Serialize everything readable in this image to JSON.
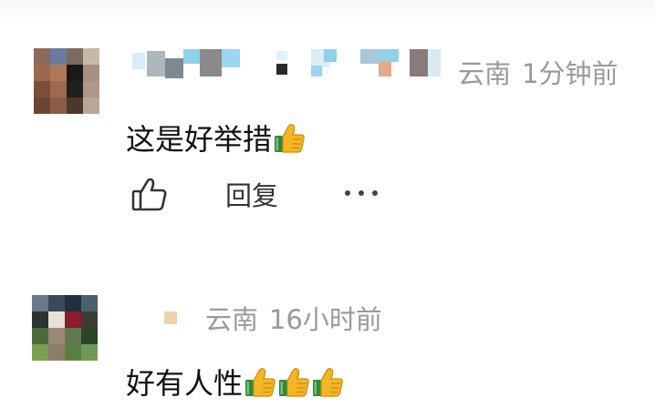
{
  "comments": [
    {
      "avatar_colors": [
        "#8a6a58",
        "#6a7aa0",
        "#7a6a60",
        "#c8b8a8",
        "#9a6a50",
        "#b07858",
        "#1c1818",
        "#a89080",
        "#7a4e38",
        "#a06850",
        "#20201c",
        "#b09888",
        "#6a4632",
        "#8c5c44",
        "#4a3828",
        "#b8a898"
      ],
      "location": "云南",
      "time": "1分钟前",
      "text": "这是好举措",
      "emoji_count": 1,
      "actions": {
        "reply_label": "回复"
      }
    },
    {
      "avatar_colors": [
        "#6a7a8a",
        "#3a4a5a",
        "#20303c",
        "#4a6070",
        "#2c3430",
        "#e8e0d8",
        "#8c1c2c",
        "#3c3c34",
        "#4a6c3c",
        "#9a8878",
        "#607850",
        "#2c4428",
        "#7aa050",
        "#8c7c6a",
        "#5a8040",
        "#709858"
      ],
      "location": "云南",
      "time": "16小时前",
      "text": "好有人性",
      "emoji_count": 3
    }
  ],
  "colors": {
    "meta_text": "#9a9a9a",
    "content_text": "#111111",
    "emoji_thumb": "#f5b625",
    "emoji_cuff": "#2f8a3c"
  },
  "icons": {
    "like": "thumbs-up-outline-icon",
    "more": "more-horizontal-icon",
    "emoji": "thumbs-up-emoji"
  }
}
